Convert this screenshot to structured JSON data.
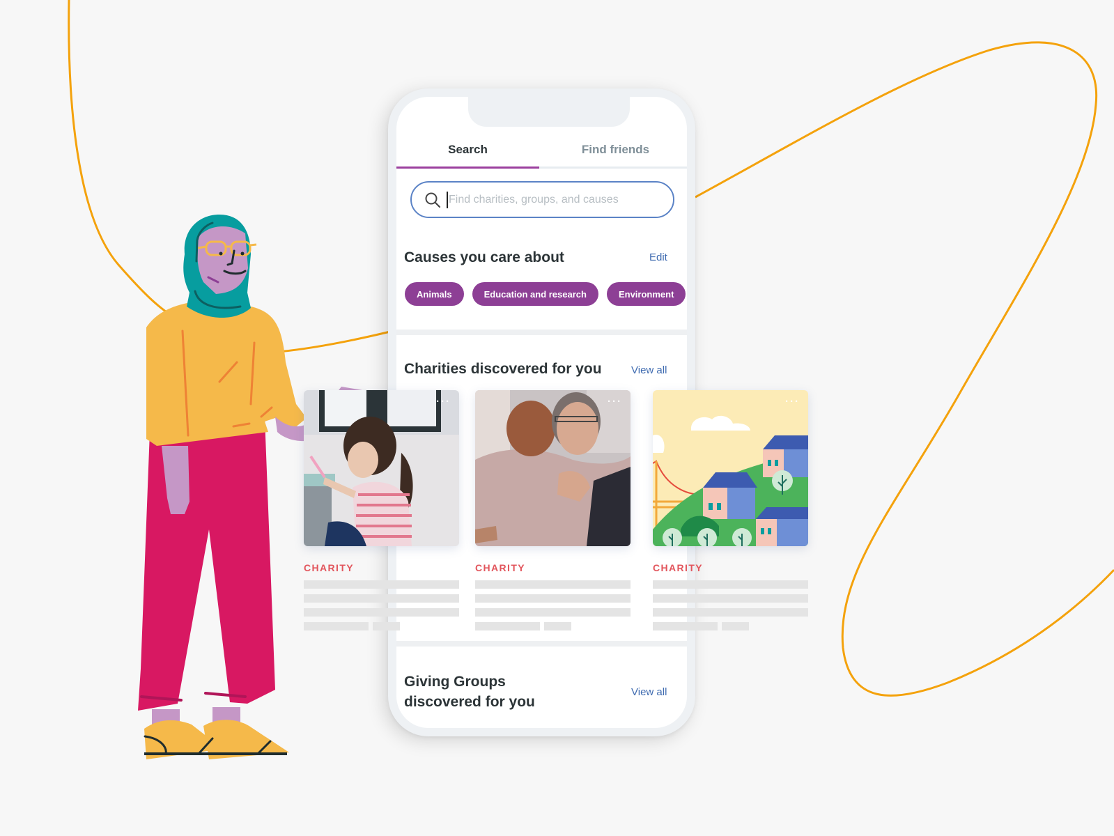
{
  "colors": {
    "background": "#f7f7f7",
    "accent_purple": "#9b3f9e",
    "chip_purple": "#8d3f95",
    "link_blue": "#3f6bb0",
    "charity_red": "#e2555c",
    "curve_orange": "#f4a20c"
  },
  "tabs": [
    {
      "label": "Search",
      "active": true
    },
    {
      "label": "Find friends",
      "active": false
    }
  ],
  "search": {
    "placeholder": "Find charities, groups, and causes",
    "value": "",
    "icon": "search-icon"
  },
  "causes": {
    "title": "Causes you care about",
    "edit_label": "Edit",
    "chips": [
      "Animals",
      "Education and research",
      "Environment"
    ]
  },
  "charities": {
    "title": "Charities discovered for you",
    "view_all_label": "View all",
    "cards": [
      {
        "type_label": "CHARITY",
        "image": "girl-painting-photo",
        "more_icon": "more-horizontal-icon"
      },
      {
        "type_label": "CHARITY",
        "image": "men-hugging-photo",
        "more_icon": "more-horizontal-icon"
      },
      {
        "type_label": "CHARITY",
        "image": "hillside-town-illustration",
        "more_icon": "more-horizontal-icon"
      }
    ]
  },
  "giving_groups": {
    "title_line1": "Giving Groups",
    "title_line2": "discovered for you",
    "view_all_label": "View all"
  }
}
